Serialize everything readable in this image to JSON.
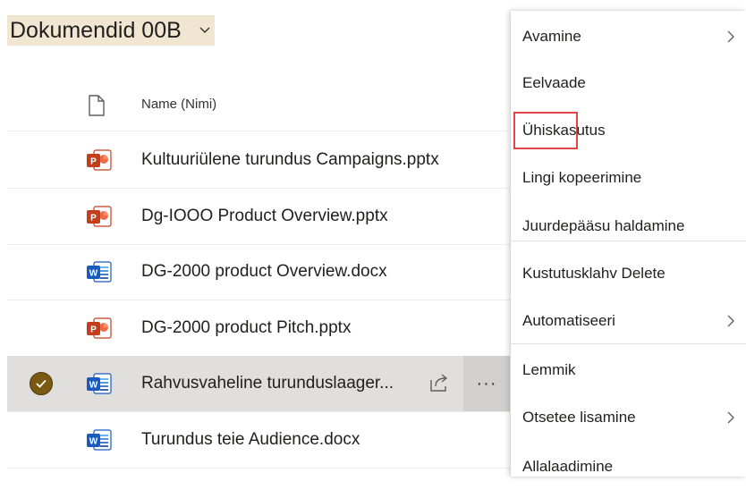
{
  "library": {
    "title": "Dokumendid 00B"
  },
  "list": {
    "column_name": "Name (Nimi)",
    "rows": [
      {
        "name": "Kultuuriülene turundus Campaigns.pptx",
        "type": "pptx",
        "selected": false
      },
      {
        "name": "Dg-IOOO Product Overview.pptx",
        "type": "pptx",
        "selected": false
      },
      {
        "name": "DG-2000 product Overview.docx",
        "type": "docx",
        "selected": false
      },
      {
        "name": "DG-2000 product Pitch.pptx",
        "type": "pptx",
        "selected": false
      },
      {
        "name": "Rahvusvaheline turunduslaager...",
        "type": "docx",
        "selected": true
      },
      {
        "name": "Turundus teie Audience.docx",
        "type": "docx",
        "selected": false
      }
    ]
  },
  "context_menu": {
    "items": [
      {
        "label": "Avamine",
        "submenu": true
      },
      {
        "label": "Eelvaade",
        "submenu": false
      },
      {
        "label": "Ühiskasutus",
        "submenu": false,
        "highlighted": true
      },
      {
        "label": "Lingi kopeerimine",
        "submenu": false
      },
      {
        "label": "Juurdepääsu haldamine",
        "submenu": false
      },
      {
        "label": "Kustutusklahv Delete",
        "submenu": false
      },
      {
        "label": "Automatiseeri",
        "submenu": true
      },
      {
        "label": "Lemmik",
        "submenu": false
      },
      {
        "label": "Otsetee lisamine",
        "submenu": true
      },
      {
        "label": "Allalaadimine",
        "submenu": false
      }
    ]
  },
  "colors": {
    "selection_check": "#7a5a12",
    "title_highlight": "#f1e6d2",
    "callout_border": "#e04848",
    "ppt_brand": "#c43e1c",
    "word_brand": "#185abd"
  }
}
